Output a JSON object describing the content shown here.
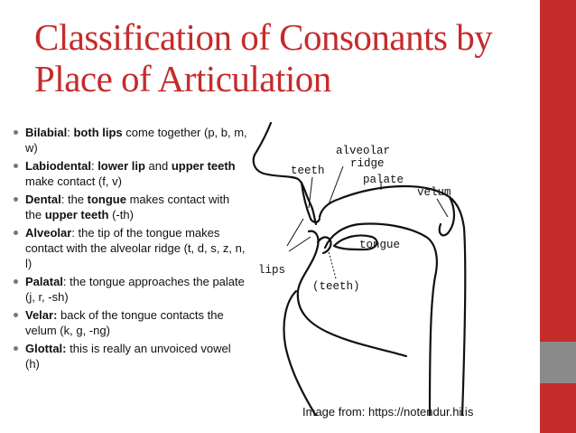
{
  "slide": {
    "title_line1": "Classification of Consonants by",
    "title_line2": "Place of Articulation",
    "bullets": [
      {
        "term": "Bilabial",
        "sep": ": ",
        "em1": "both lips",
        "t1": " come together (p, b, m, w)"
      },
      {
        "term": "Labiodental",
        "sep": ": ",
        "em1": "lower lip",
        "t1": " and ",
        "em2": "upper teeth",
        "t2": " make contact (f, v)"
      },
      {
        "term": "Dental",
        "sep": ": the ",
        "em1": "tongue",
        "t1": " makes contact with the ",
        "em2": "upper teeth",
        "t2": " (-th)"
      },
      {
        "term": "Alveolar",
        "sep": ": ",
        "t1": "the tip of the tongue makes contact with the alveolar ridge (t, d, s, z, n, l)"
      },
      {
        "term": "Palatal",
        "sep": ": ",
        "t1": "the tongue approaches the palate (j, r, -sh)"
      },
      {
        "term": "Velar:",
        "sep": " ",
        "t1": "back of the tongue contacts the velum (k, g, -ng)"
      },
      {
        "term": "Glottal:",
        "sep": " ",
        "t1": "this is really an unvoiced vowel (h)"
      }
    ],
    "caption": "Image from: https://notendur.hi.is"
  },
  "diagram": {
    "labels": {
      "alveolar_1": "alveolar",
      "alveolar_2": "ridge",
      "teeth": "teeth",
      "palate": "palate",
      "velum": "velum",
      "tongue": "tongue",
      "lips": "lips",
      "teeth_lower": "(teeth)"
    }
  },
  "colors": {
    "accent": "#c62b2b",
    "accent_gray": "#8a8a8a",
    "text": "#111111"
  }
}
